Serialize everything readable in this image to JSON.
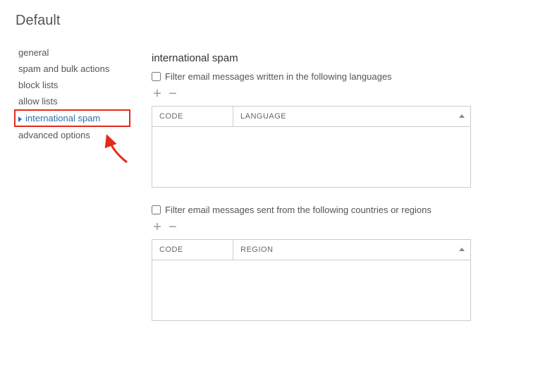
{
  "header": {
    "title": "Default"
  },
  "sidebar": {
    "items": [
      {
        "label": "general",
        "selected": false
      },
      {
        "label": "spam and bulk actions",
        "selected": false
      },
      {
        "label": "block lists",
        "selected": false
      },
      {
        "label": "allow lists",
        "selected": false
      },
      {
        "label": "international spam",
        "selected": true
      },
      {
        "label": "advanced options",
        "selected": false
      }
    ]
  },
  "main": {
    "section_title": "international spam",
    "languages": {
      "checkbox_label": "Filter email messages written in the following languages",
      "checked": false,
      "table": {
        "col_code": "CODE",
        "col_lang": "LANGUAGE"
      }
    },
    "regions": {
      "checkbox_label": "Filter email messages sent from the following countries or regions",
      "checked": false,
      "table": {
        "col_code": "CODE",
        "col_region": "REGION"
      }
    }
  },
  "icons": {
    "plus": "+",
    "minus": "−"
  },
  "annotation": {
    "highlight_color": "#e22b1c"
  }
}
